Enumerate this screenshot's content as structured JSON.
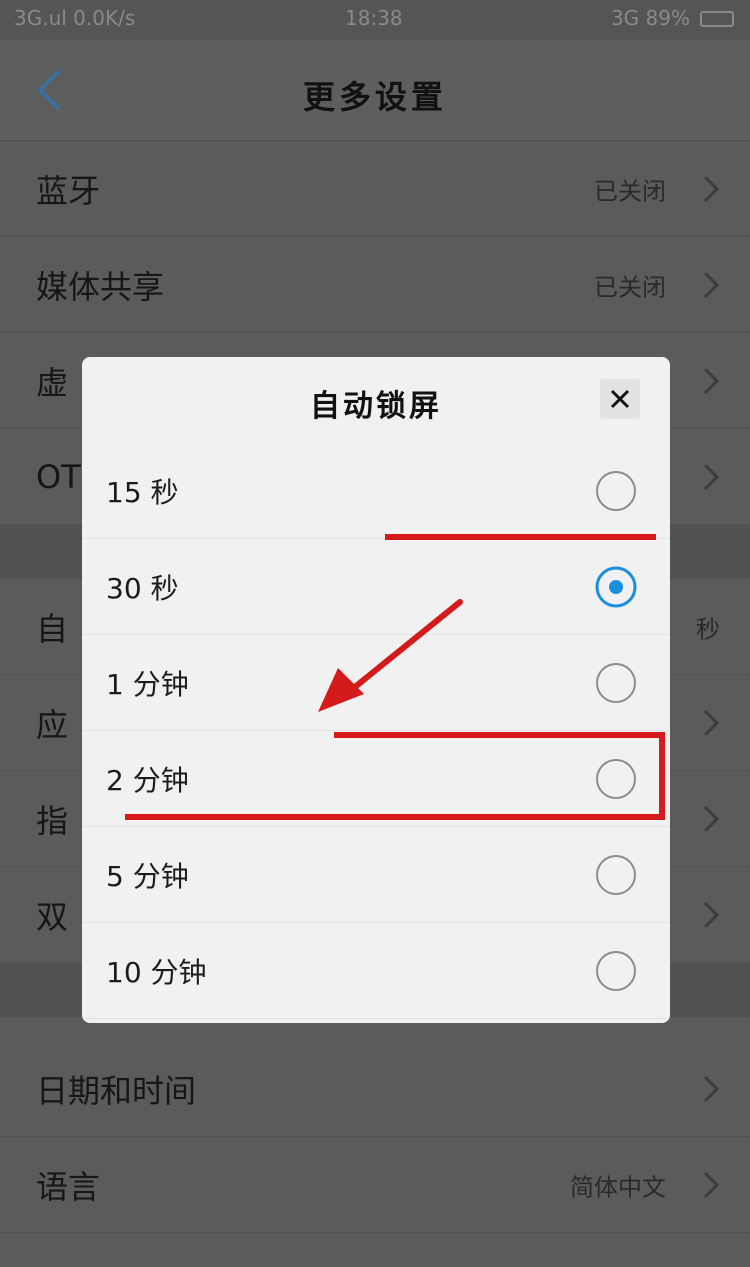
{
  "status_bar": {
    "left": "3G.ul 0.0K/s",
    "time": "18:38",
    "right": "3G 89%"
  },
  "header": {
    "title": "更多设置"
  },
  "settings": [
    {
      "label": "蓝牙",
      "value": "已关闭"
    },
    {
      "label": "媒体共享",
      "value": "已关闭"
    },
    {
      "label": "虚",
      "value": ""
    },
    {
      "label": "OT",
      "value": ""
    },
    {
      "label": "自",
      "value": "秒"
    },
    {
      "label": "应",
      "value": ""
    },
    {
      "label": "指",
      "value": ""
    },
    {
      "label": "双",
      "value": ""
    },
    {
      "label": "日期和时间",
      "value": ""
    },
    {
      "label": "语言",
      "value": "简体中文"
    }
  ],
  "dialog": {
    "title": "自动锁屏",
    "options": [
      {
        "label": "15 秒",
        "selected": false
      },
      {
        "label": "30 秒",
        "selected": true
      },
      {
        "label": "1 分钟",
        "selected": false
      },
      {
        "label": "2 分钟",
        "selected": false
      },
      {
        "label": "5 分钟",
        "selected": false
      },
      {
        "label": "10 分钟",
        "selected": false
      }
    ]
  },
  "colors": {
    "accent": "#1a8fe0",
    "annotation": "#d41a1a",
    "overlay": "#5b5b5b"
  }
}
